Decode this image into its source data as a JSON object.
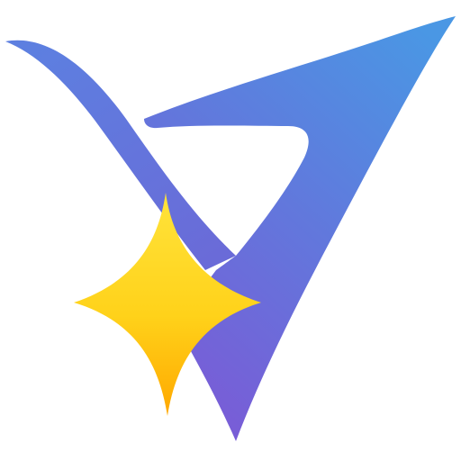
{
  "canvas": {
    "background": "#ffffff"
  },
  "logo": {
    "icon": "stylized-v-logo-with-sparkle",
    "colors": {
      "v_gradient_top": "#4e8ee0",
      "v_gradient_mid": "#6674d8",
      "v_gradient_bottom": "#7b5fd6",
      "star_top": "#ffd93a",
      "star_bottom": "#ffb000"
    }
  }
}
